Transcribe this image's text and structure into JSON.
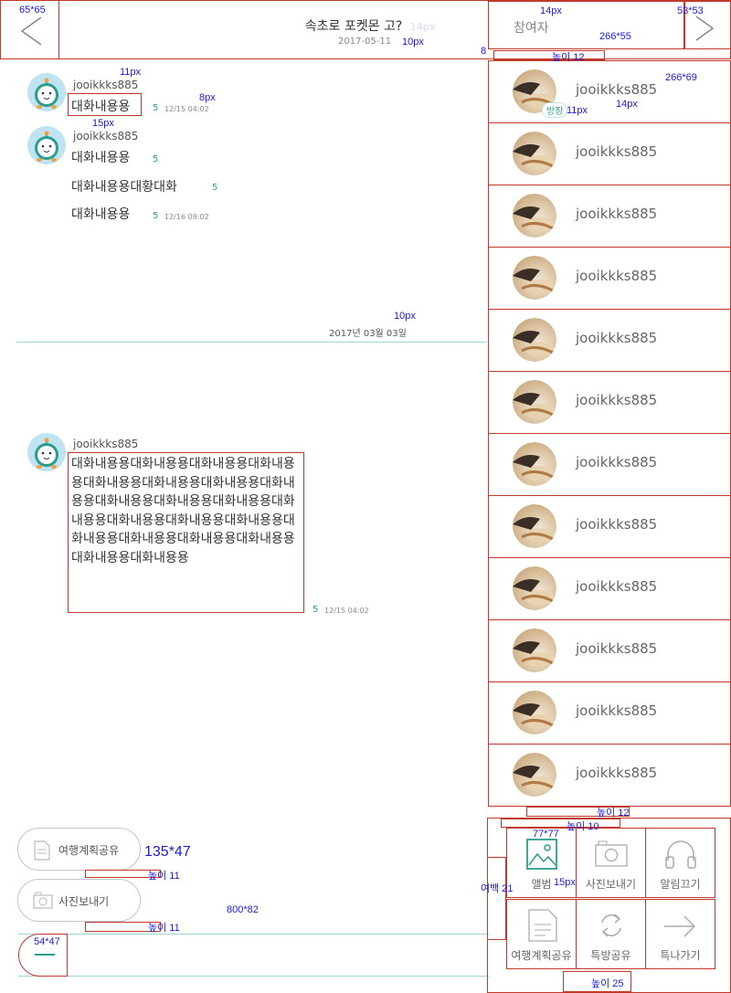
{
  "header": {
    "title": "속초로 포켓몬 고?",
    "date": "2017-05-11",
    "participants_label": "참여자"
  },
  "chat": {
    "messages": [
      {
        "user": "jooikkks885",
        "text": "대화내용용",
        "read_count": "5",
        "time": "12/15 04:02"
      },
      {
        "user": "jooikkks885",
        "lines": [
          {
            "text": "대화내용용",
            "read_count": "5"
          },
          {
            "text": "대화내용용대황대화",
            "read_count": "5"
          },
          {
            "text": "대화내용용",
            "read_count": "5",
            "time": "12/16 08:02"
          }
        ]
      },
      {
        "user": "jooikkks885",
        "text": "대화내용용대화내용용대화내용용대화내용용대화내용용대화내용용대화내용용대화내용용대화내용용대화내용용대화내용용대화내용용대화내용용대화내용용대화내용용대화내용용대화내용용대화내용용대화내용용대화내용용대화내용용",
        "read_count": "5",
        "time": "12/15 04:02"
      }
    ],
    "date_divider": "2017년 03월 03일"
  },
  "participants": [
    {
      "name": "jooikkks885",
      "badge": "방장"
    },
    {
      "name": "jooikkks885"
    },
    {
      "name": "jooikkks885"
    },
    {
      "name": "jooikkks885"
    },
    {
      "name": "jooikkks885"
    },
    {
      "name": "jooikkks885"
    },
    {
      "name": "jooikkks885"
    },
    {
      "name": "jooikkks885"
    },
    {
      "name": "jooikkks885"
    },
    {
      "name": "jooikkks885"
    },
    {
      "name": "jooikkks885"
    },
    {
      "name": "jooikkks885"
    }
  ],
  "quick_buttons": {
    "share_plan": "여행계획공유",
    "send_photo": "사진보내기"
  },
  "actions": [
    {
      "label": "앨범",
      "icon": "album-icon"
    },
    {
      "label": "사진보내기",
      "icon": "camera-icon"
    },
    {
      "label": "알림끄기",
      "icon": "headphones-icon"
    },
    {
      "label": "여행계획공유",
      "icon": "document-icon"
    },
    {
      "label": "특방공유",
      "icon": "refresh-icon"
    },
    {
      "label": "특나가기",
      "icon": "arrow-right-icon"
    }
  ],
  "annotations": {
    "a1": "65*65",
    "a2": "14px",
    "a3": "10px",
    "a4": "14px",
    "a5": "53*53",
    "a6": "266*55",
    "a7": "8",
    "a8": "높이 12",
    "a9": "266*69",
    "a10": "11px",
    "a11": "14px",
    "a12": "11px",
    "a13": "8px",
    "a14": "15px",
    "a15": "10px",
    "a16": "높이 12",
    "a17": "높이 10",
    "a18": "77*77",
    "a19": "여백 21",
    "a20": "15px",
    "a21": "135*47",
    "a22": "높이 11",
    "a23": "800*82",
    "a24": "높이 11",
    "a25": "54*47",
    "a26": "높이 25"
  },
  "colors": {
    "accent": "#2a9d8f",
    "annotation": "#1a1adb",
    "guide_box": "#c0392b"
  }
}
